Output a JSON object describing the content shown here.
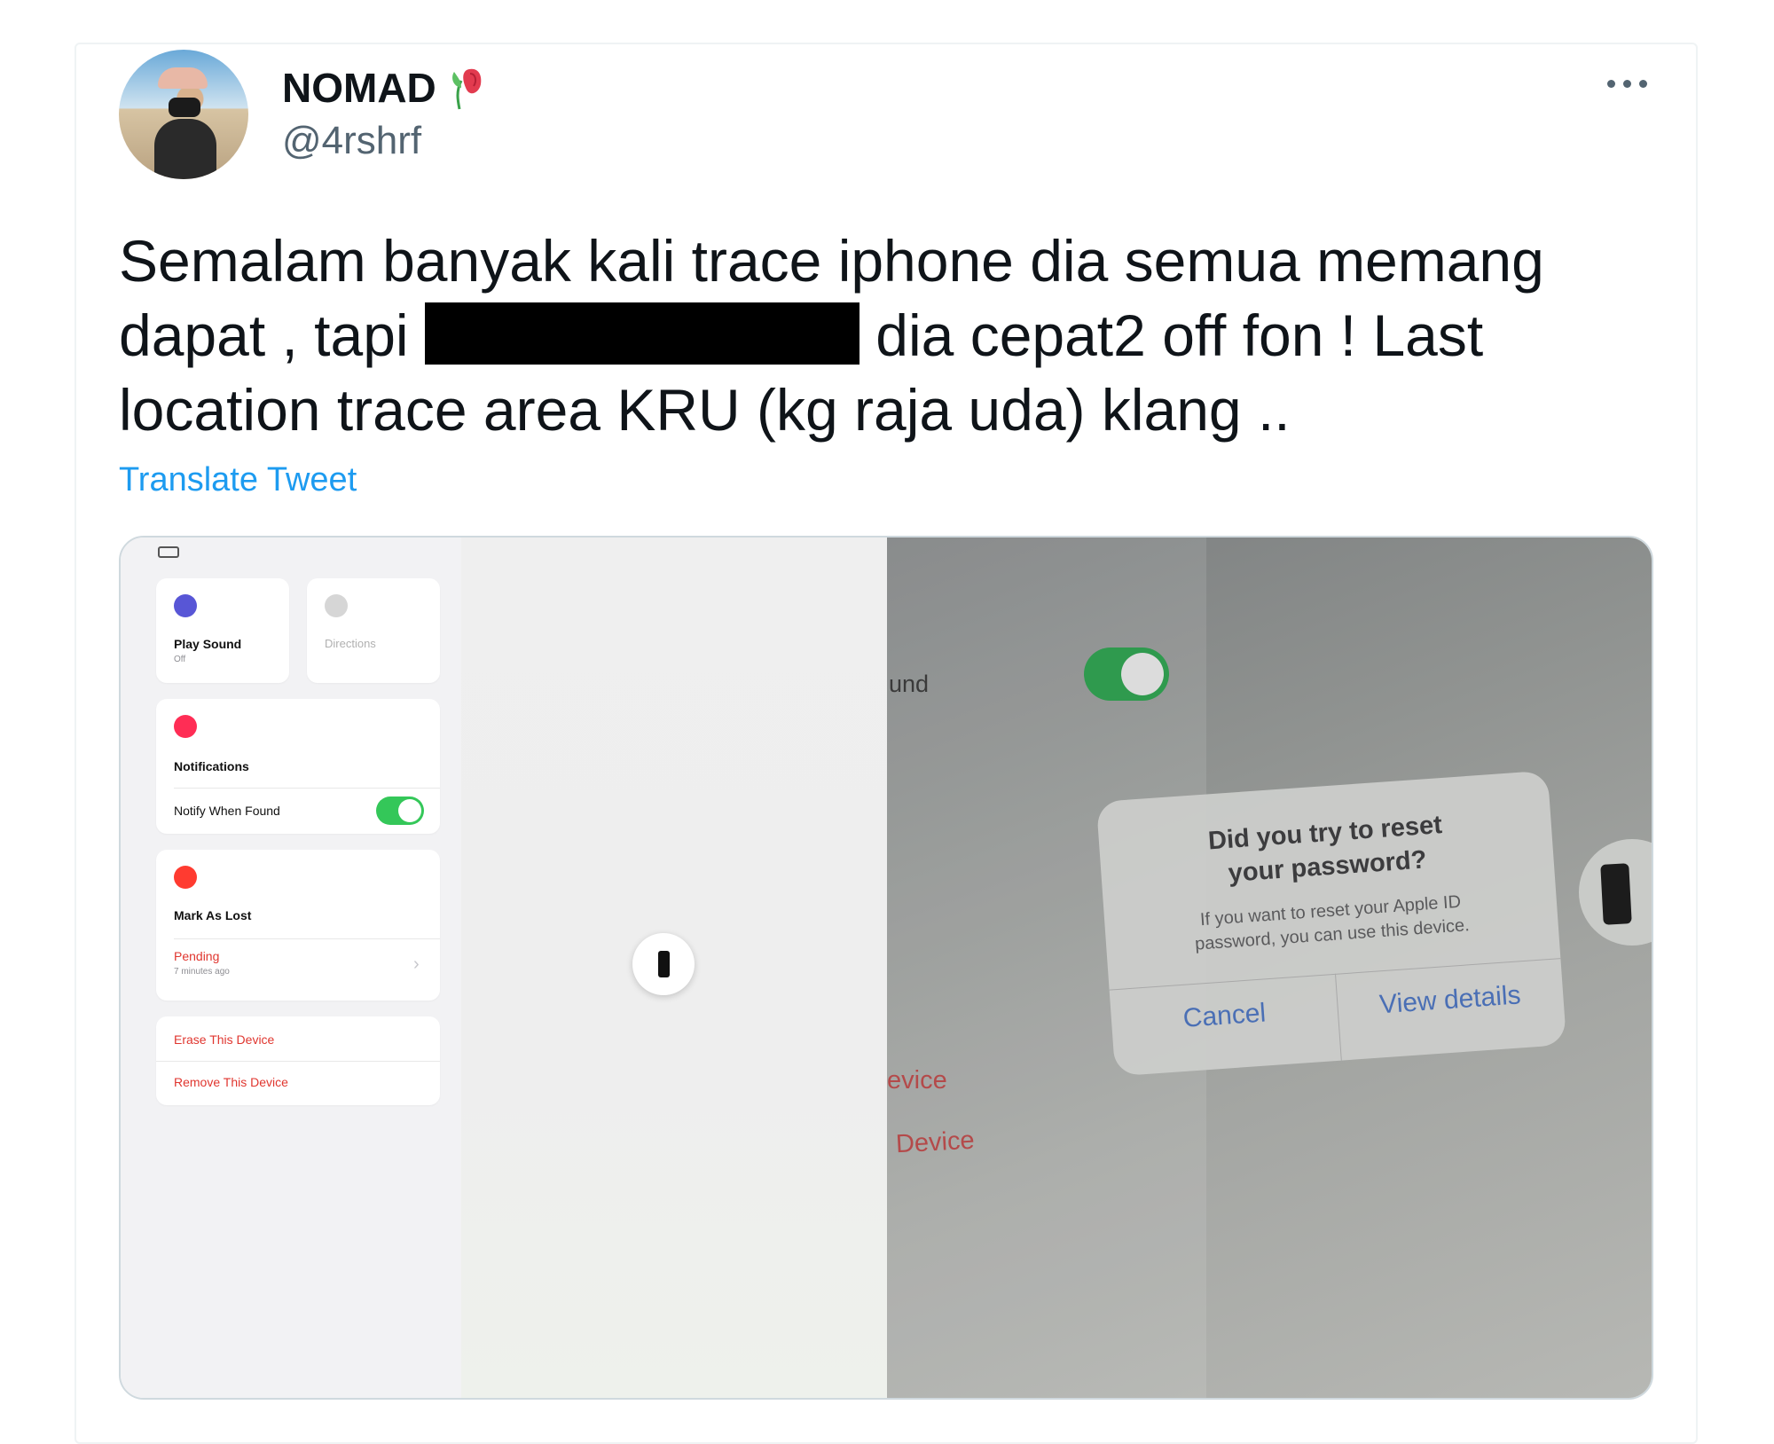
{
  "tweet": {
    "author_name": "NOMAD",
    "author_handle": "@4rshrf",
    "text_line1": "Semalam banyak kali trace iphone dia semua memang",
    "text_line2_pre": "dapat , tapi",
    "text_line2_post": "dia cepat2 off fon ! Last",
    "text_line3": "location trace area KRU (kg raja uda) klang ..",
    "translate_label": "Translate Tweet",
    "icons": [
      "flower-icon",
      "more-icon"
    ]
  },
  "left_screenshot": {
    "play_sound": "Play Sound",
    "play_sound_sub": "Off",
    "directions": "Directions",
    "notifications": "Notifications",
    "notify_when_found": "Notify When Found",
    "mark_as_lost": "Mark As Lost",
    "pending": "Pending",
    "pending_time": "7 minutes ago",
    "erase": "Erase This Device",
    "remove": "Remove This Device"
  },
  "right_screenshot": {
    "fragment_sound": "und",
    "fragment_device1": "evice",
    "fragment_device2": "Device",
    "dialog_title_1": "Did you try to reset",
    "dialog_title_2": "your password?",
    "dialog_body_1": "If you want to reset your Apple ID",
    "dialog_body_2": "password, you can use this device.",
    "cancel": "Cancel",
    "view_details": "View details"
  },
  "colors": {
    "link": "#1d9bf0",
    "text": "#0f1419",
    "secondary": "#536471",
    "ios_green": "#34c759",
    "ios_red": "#e0362f"
  }
}
